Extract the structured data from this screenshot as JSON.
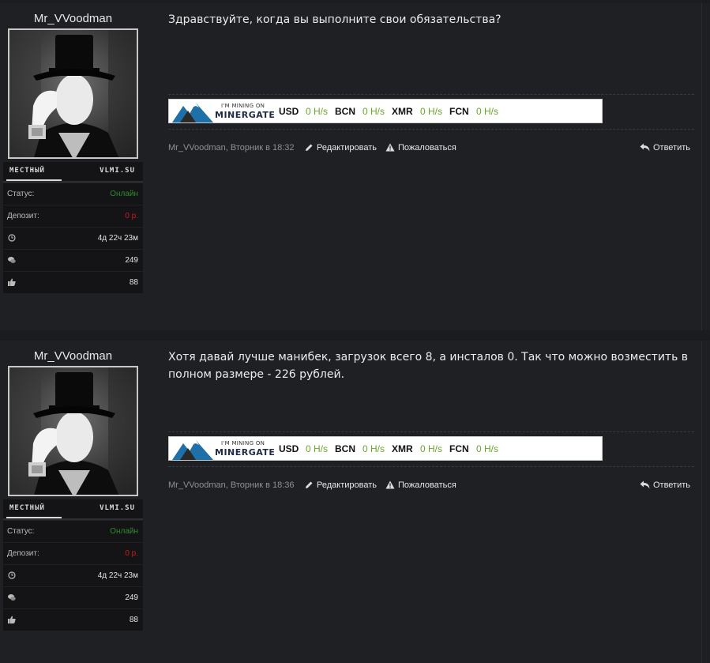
{
  "posts": [
    {
      "username": "Mr_VVoodman",
      "rank_left": "МЕСТНЫЙ",
      "rank_right": "VLMI.SU",
      "status_label": "Статус:",
      "status_value": "Онлайн",
      "deposit_label": "Депозит:",
      "deposit_value": "0 р.",
      "time_online": "4д 22ч 23м",
      "messages": "249",
      "likes": "88",
      "message": "Здравствуйте, когда вы выполните свои обязательства?",
      "meta_author": "Mr_VVoodman, Вторник в 18:32",
      "edit_label": "Редактировать",
      "report_label": "Пожаловаться",
      "reply_label": "Ответить"
    },
    {
      "username": "Mr_VVoodman",
      "rank_left": "МЕСТНЫЙ",
      "rank_right": "VLMI.SU",
      "status_label": "Статус:",
      "status_value": "Онлайн",
      "deposit_label": "Депозит:",
      "deposit_value": "0 р.",
      "time_online": "4д 22ч 23м",
      "messages": "249",
      "likes": "88",
      "message": "Хотя давай лучше манибек, загрузок всего 8, а инсталов 0. Так что можно возместить в полном размере - 226 рублей.",
      "meta_author": "Mr_VVoodman, Вторник в 18:36",
      "edit_label": "Редактировать",
      "report_label": "Пожаловаться",
      "reply_label": "Ответить"
    }
  ],
  "banner": {
    "tagline": "I'M MINING ON",
    "brand": "MINERGATE",
    "coins": [
      {
        "name": "USD",
        "rate": "0 H/s"
      },
      {
        "name": "BCN",
        "rate": "0 H/s"
      },
      {
        "name": "XMR",
        "rate": "0 H/s"
      },
      {
        "name": "FCN",
        "rate": "0 H/s"
      }
    ]
  },
  "colors": {
    "background": "#1b1c1f",
    "online": "#2e8b2e",
    "deposit": "#c81d1d",
    "hashrate": "#6aa52b"
  }
}
